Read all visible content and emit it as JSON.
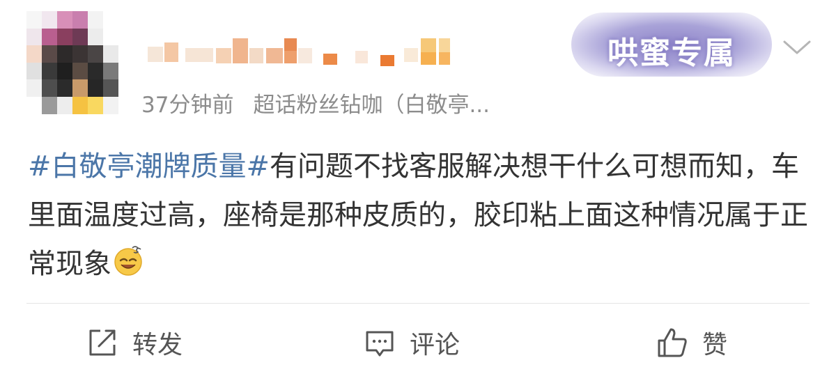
{
  "post": {
    "time": "37分钟前",
    "source": "超话粉丝钻咖（白敬亭...",
    "badge": "哄蜜专属",
    "topic": "#白敬亭潮牌质量#",
    "body": "有问题不找客服解决想干什么可想而知，车里面温度过高，座椅是那种皮质的，胶印粘上面这种情况属于正常现象"
  },
  "actions": {
    "repost": "转发",
    "comment": "评论",
    "like": "赞"
  },
  "icons": {
    "menu": "chevron-down-icon",
    "emoji": "dizzy-smile-emoji",
    "repost": "repost-icon",
    "comment": "comment-icon",
    "like": "thumbs-up-icon"
  },
  "colors": {
    "topic": "#4b76a8",
    "text": "#333333",
    "meta": "#8c8c8c",
    "badge": "#8f85c9"
  }
}
